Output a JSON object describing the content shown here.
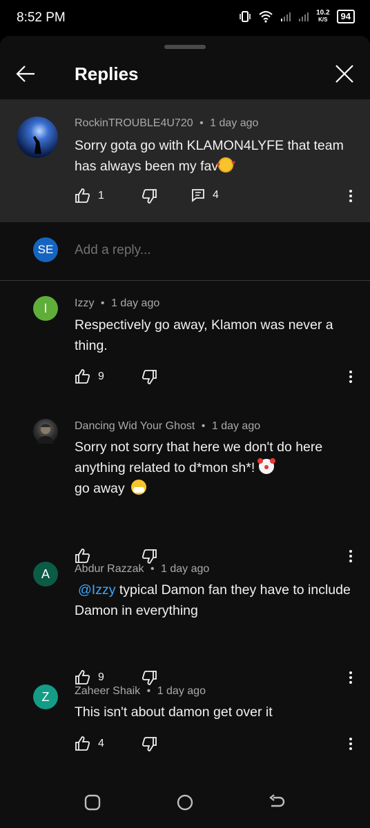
{
  "status_bar": {
    "time": "8:52 PM",
    "net_speed_value": "10.2",
    "net_speed_unit": "K/S",
    "battery": "94"
  },
  "header": {
    "title": "Replies"
  },
  "parent_comment": {
    "author": "RockinTROUBLE4U720",
    "time": "1 day ago",
    "text": "Sorry gota go with KLAMON4LYFE that team has always been my fav",
    "likes": "1",
    "replies": "4"
  },
  "reply_box": {
    "avatar_initials": "SE",
    "placeholder": "Add a reply..."
  },
  "replies": [
    {
      "author": "Izzy",
      "time": "1 day ago",
      "avatar_letter": "I",
      "avatar_color": "#5fae3a",
      "text": "Respectively go away, Klamon was never a thing.",
      "likes": "9"
    },
    {
      "author": "Dancing Wid Your Ghost",
      "time": "1 day ago",
      "text_line1": "Sorry not sorry that here we don't do here anything related to d*mon sh*!",
      "text_line2": "go away",
      "likes": ""
    },
    {
      "author": "Abdur Razzak",
      "time": "1 day ago",
      "avatar_letter": "A",
      "avatar_color": "#0b5b45",
      "mention": "@Izzy",
      "text": "typical Damon fan they have to include Damon in everything",
      "likes": "9"
    },
    {
      "author": "Zaheer Shaik",
      "time": "1 day ago",
      "avatar_letter": "Z",
      "avatar_color": "#139c86",
      "text": "This isn't about damon get over it",
      "likes": "4"
    }
  ],
  "meta_separator": "•",
  "colors": {
    "sheet_bg": "#0f0f0f",
    "highlight_bg": "#272727",
    "secondary_text": "#aaaaaa",
    "mention": "#3ea6ff"
  }
}
